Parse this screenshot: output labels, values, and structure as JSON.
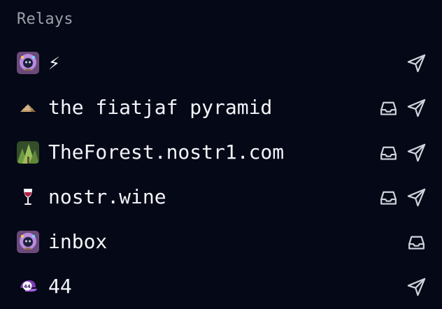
{
  "section": {
    "title": "Relays"
  },
  "colors": {
    "background": "#050816",
    "title": "#9aa0ac",
    "text": "#f3f4f8",
    "icon": "#cfd3db"
  },
  "relays": [
    {
      "name": "⚡",
      "avatar": "purple-hooded-avatar-icon",
      "inbox": false,
      "outbox": true
    },
    {
      "name": "the fiatjaf pyramid",
      "avatar": "pyramid-icon",
      "inbox": true,
      "outbox": true
    },
    {
      "name": "TheForest.nostr1.com",
      "avatar": "forest-avatar-icon",
      "inbox": true,
      "outbox": true
    },
    {
      "name": "nostr.wine",
      "avatar": "wine-glass-icon",
      "inbox": true,
      "outbox": true
    },
    {
      "name": "inbox",
      "avatar": "purple-hooded-avatar-icon",
      "inbox": true,
      "outbox": false
    },
    {
      "name": "44",
      "avatar": "cap-44-icon",
      "inbox": false,
      "outbox": true
    }
  ]
}
